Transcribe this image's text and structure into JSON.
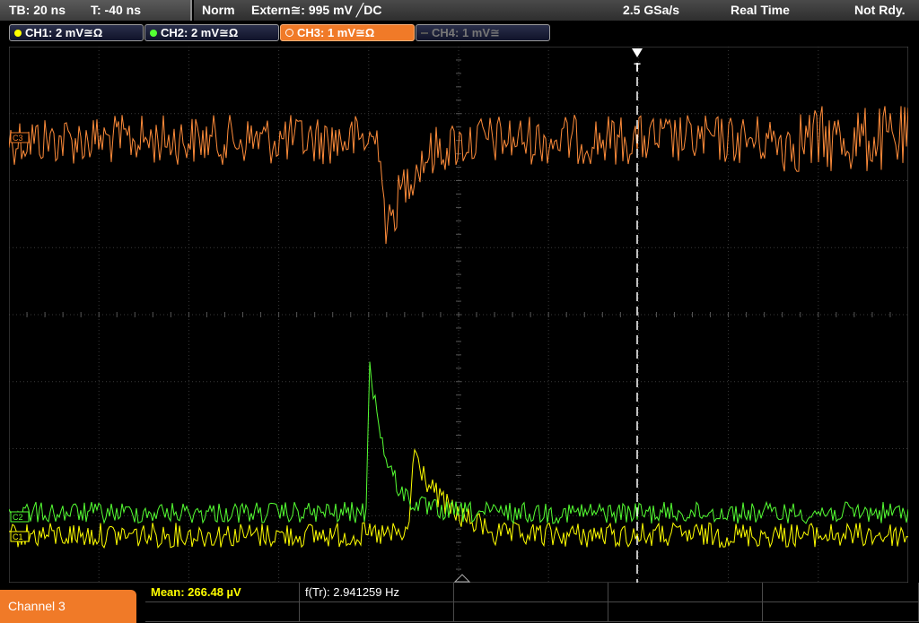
{
  "topbar": {
    "timebase": "TB: 20 ns",
    "trigger_offset": "T: -40 ns",
    "trigger_mode": "Norm",
    "trigger_source": "Extern≅: 995 mV ╱DC",
    "sample_rate": "2.5 GSa/s",
    "acq_mode": "Real Time",
    "status": "Not Rdy."
  },
  "channels": [
    {
      "label": "CH1: 2 mV≅Ω",
      "color": "#ffff00",
      "state": "on"
    },
    {
      "label": "CH2: 2 mV≅Ω",
      "color": "#55ff33",
      "state": "on"
    },
    {
      "label": "CH3: 1 mV≅Ω",
      "color": "#f07a28",
      "state": "active"
    },
    {
      "label": "CH4: 1 mV≅",
      "color": "#666666",
      "state": "off"
    }
  ],
  "markers": {
    "ch3": "C3",
    "ch2": "C2",
    "ch1": "C1",
    "trigger": "T"
  },
  "colors": {
    "ch1": "#ffff00",
    "ch2": "#55ff33",
    "ch3": "#ff8c3a",
    "grid": "#3a3a3a"
  },
  "bottom": {
    "selected_channel": "Channel 3",
    "measurements": [
      {
        "label": "Mean: 266.48 µV"
      },
      {
        "label": "f(Tr): 2.941259 Hz"
      }
    ]
  }
}
